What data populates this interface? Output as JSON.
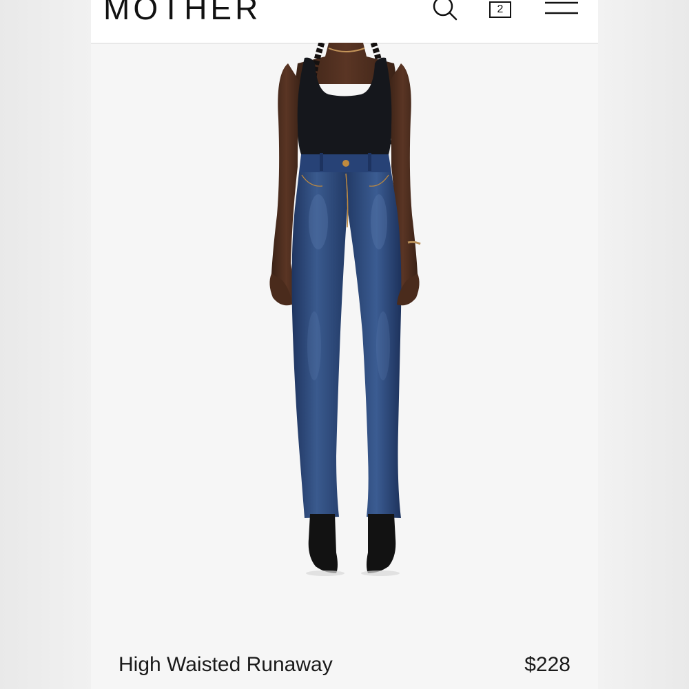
{
  "header": {
    "logo": "MOTHER",
    "cart_count": "2",
    "icons": {
      "search": "search-icon",
      "cart": "cart-icon",
      "menu": "hamburger-menu-icon"
    }
  },
  "product": {
    "name": "High Waisted Runaway",
    "price": "$228",
    "image": "model-wearing-jeans-photo"
  },
  "colors": {
    "background": "#f6f6f6",
    "text": "#111111",
    "denim": "#2d4a7a"
  }
}
